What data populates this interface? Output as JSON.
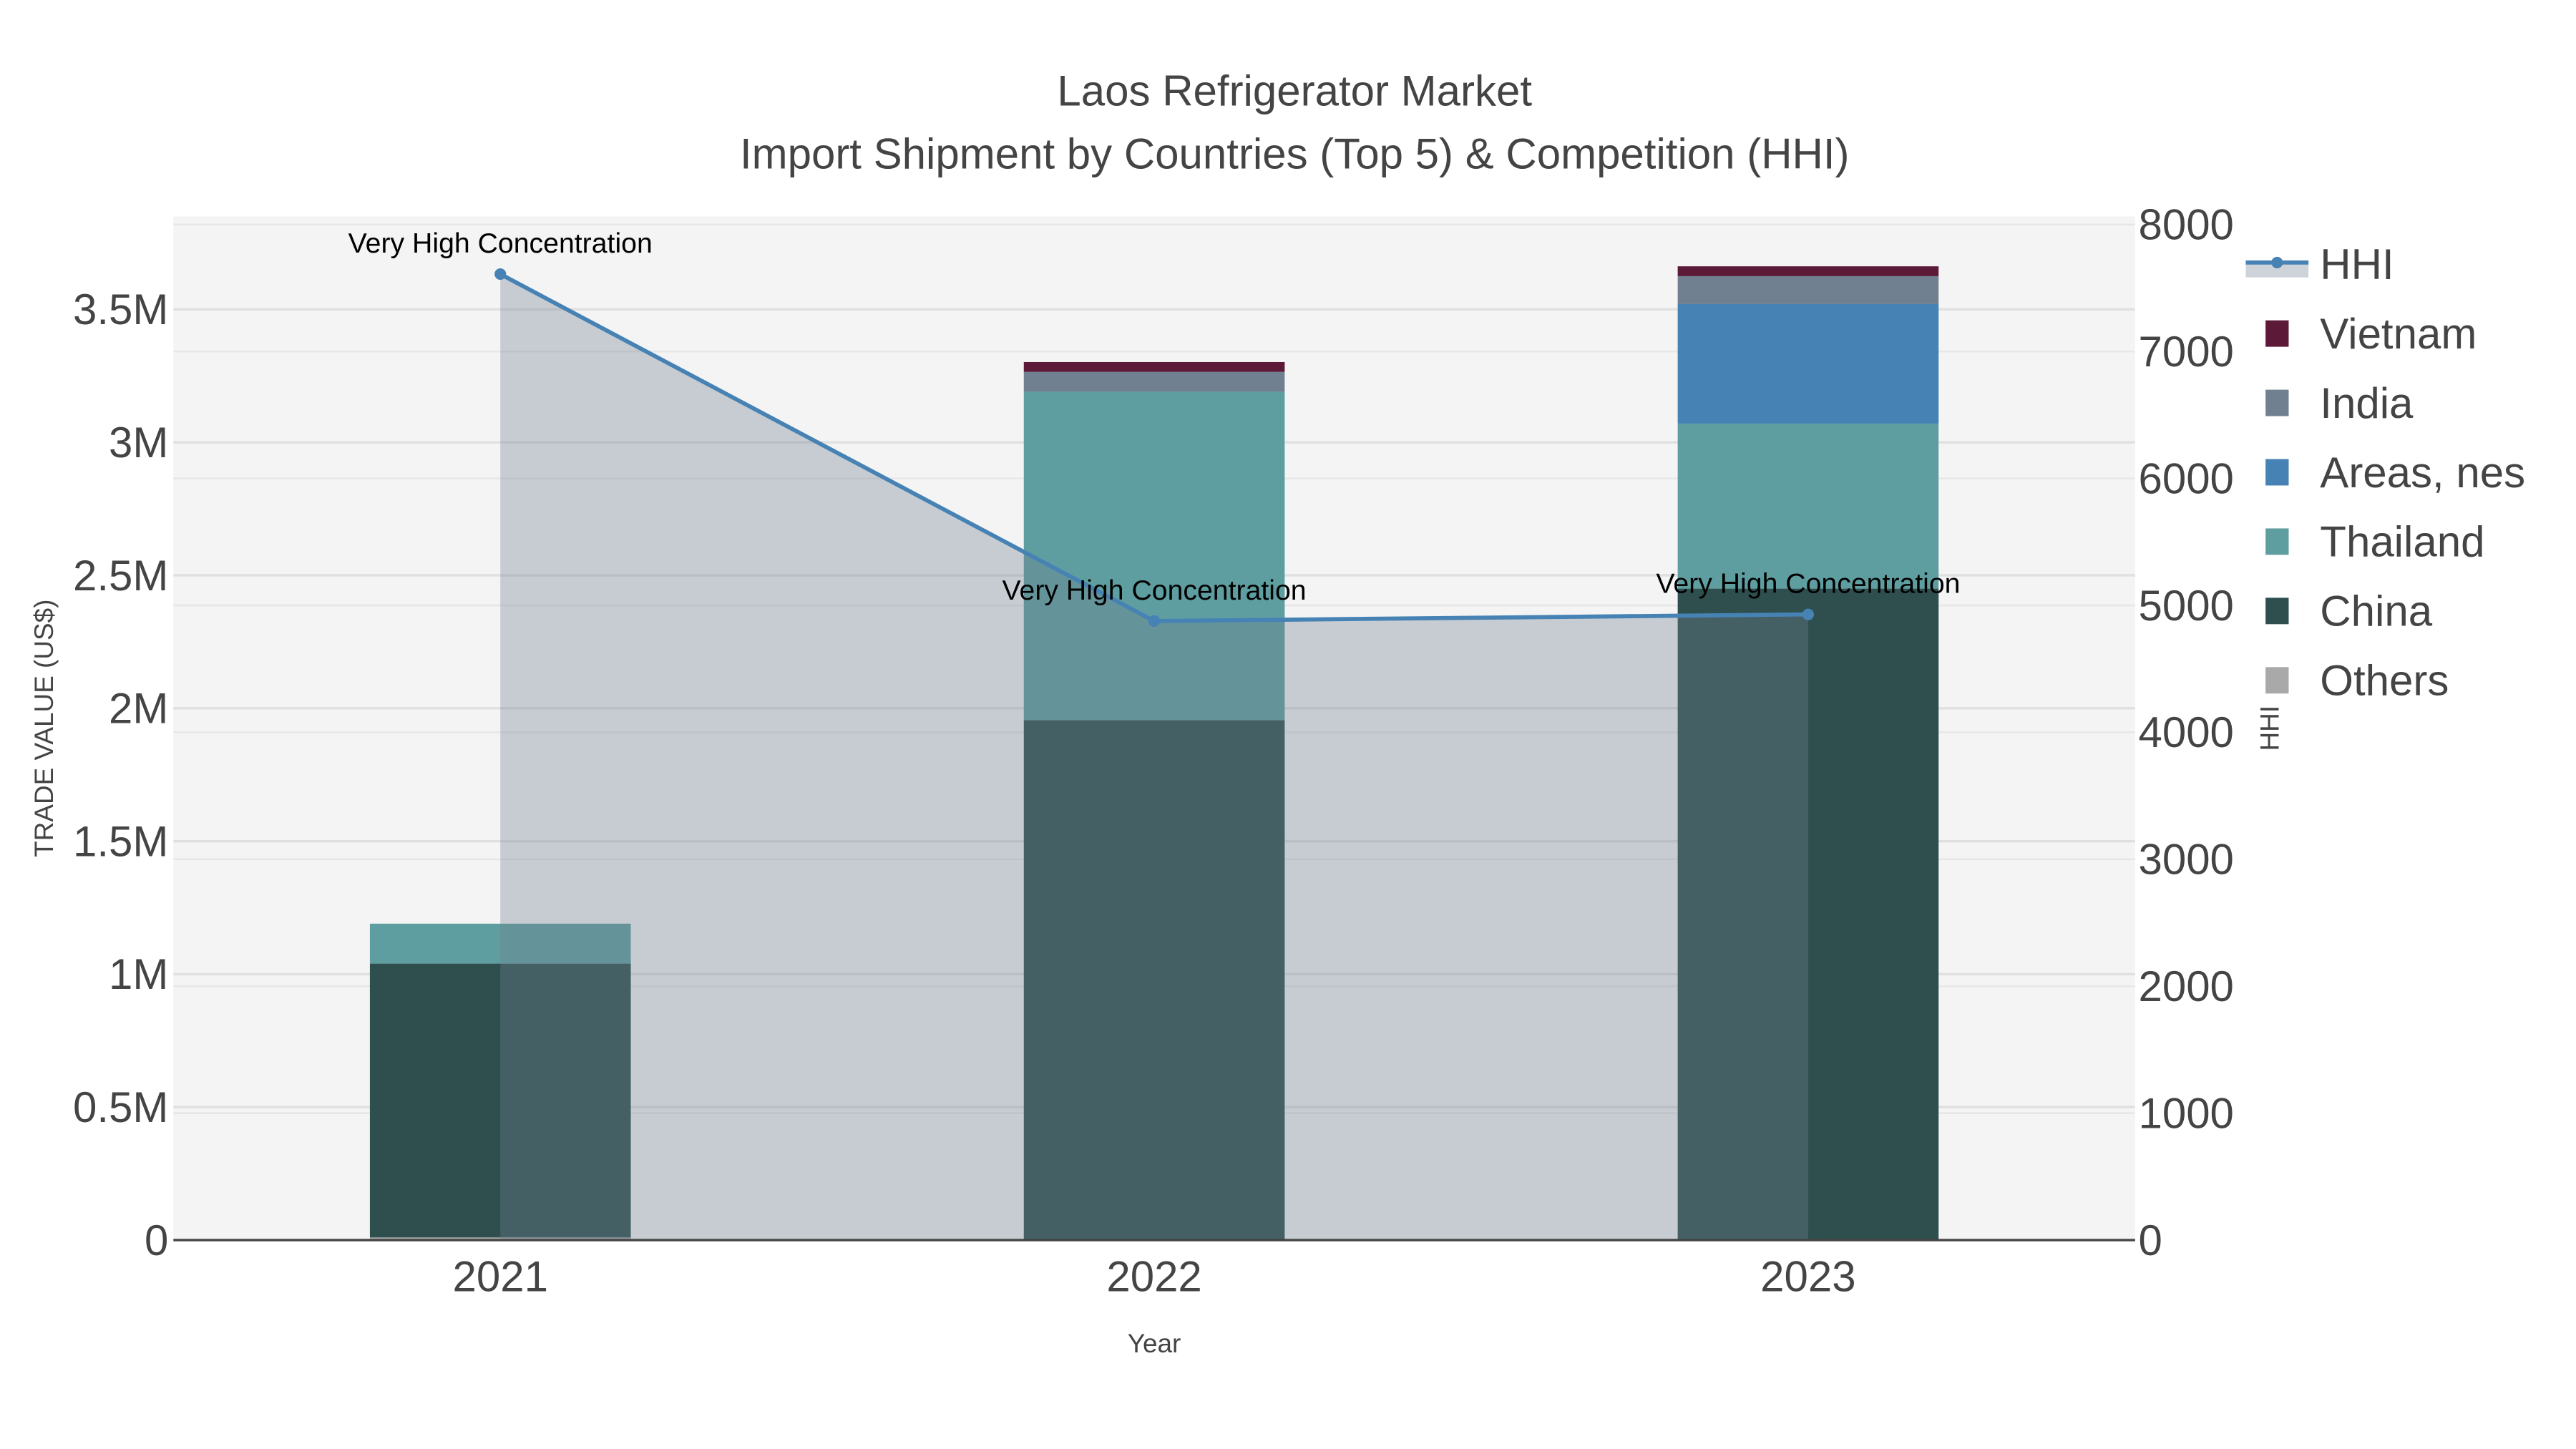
{
  "chart_data": {
    "type": "bar",
    "title": "Laos Refrigerator Market",
    "subtitle": "Import Shipment by Countries (Top 5) & Competition (HHI)",
    "xlabel": "Year",
    "ylabel": "TRADE VALUE (US$)",
    "y2label": "HHI",
    "categories": [
      "2021",
      "2022",
      "2023"
    ],
    "ylim": [
      0,
      3850000
    ],
    "y2lim": [
      0,
      8065
    ],
    "yticks": [
      {
        "v": 0,
        "label": "0"
      },
      {
        "v": 500000,
        "label": "0.5M"
      },
      {
        "v": 1000000,
        "label": "1M"
      },
      {
        "v": 1500000,
        "label": "1.5M"
      },
      {
        "v": 2000000,
        "label": "2M"
      },
      {
        "v": 2500000,
        "label": "2.5M"
      },
      {
        "v": 3000000,
        "label": "3M"
      },
      {
        "v": 3500000,
        "label": "3.5M"
      }
    ],
    "y2ticks": [
      {
        "v": 0,
        "label": "0"
      },
      {
        "v": 1000,
        "label": "1000"
      },
      {
        "v": 2000,
        "label": "2000"
      },
      {
        "v": 3000,
        "label": "3000"
      },
      {
        "v": 4000,
        "label": "4000"
      },
      {
        "v": 5000,
        "label": "5000"
      },
      {
        "v": 6000,
        "label": "6000"
      },
      {
        "v": 7000,
        "label": "7000"
      },
      {
        "v": 8000,
        "label": "8000"
      }
    ],
    "barmode": "stack",
    "series": [
      {
        "name": "Others",
        "color": "#a9a9a9",
        "values": [
          10000,
          0,
          0
        ]
      },
      {
        "name": "China",
        "color": "#2f4f4f",
        "values": [
          1030000,
          1955000,
          2450000
        ]
      },
      {
        "name": "Thailand",
        "color": "#5f9ea0",
        "values": [
          150000,
          1235000,
          620000
        ]
      },
      {
        "name": "Areas, nes",
        "color": "#4682b4",
        "values": [
          0,
          0,
          450000
        ]
      },
      {
        "name": "India",
        "color": "#708090",
        "values": [
          0,
          75000,
          105000
        ]
      },
      {
        "name": "Vietnam",
        "color": "#5c1a38",
        "values": [
          0,
          37000,
          37000
        ]
      }
    ],
    "line": {
      "name": "HHI",
      "color": "#4682b4",
      "axis": "y2",
      "values": [
        7610,
        4877,
        4929
      ],
      "fill": "tozeroy"
    },
    "annotations": [
      "Very High Concentration",
      "Very High Concentration",
      "Very High Concentration"
    ],
    "legend": {
      "placement": "right",
      "order": [
        "HHI",
        "Vietnam",
        "India",
        "Areas, nes",
        "Thailand",
        "China",
        "Others"
      ]
    },
    "grid": true
  }
}
